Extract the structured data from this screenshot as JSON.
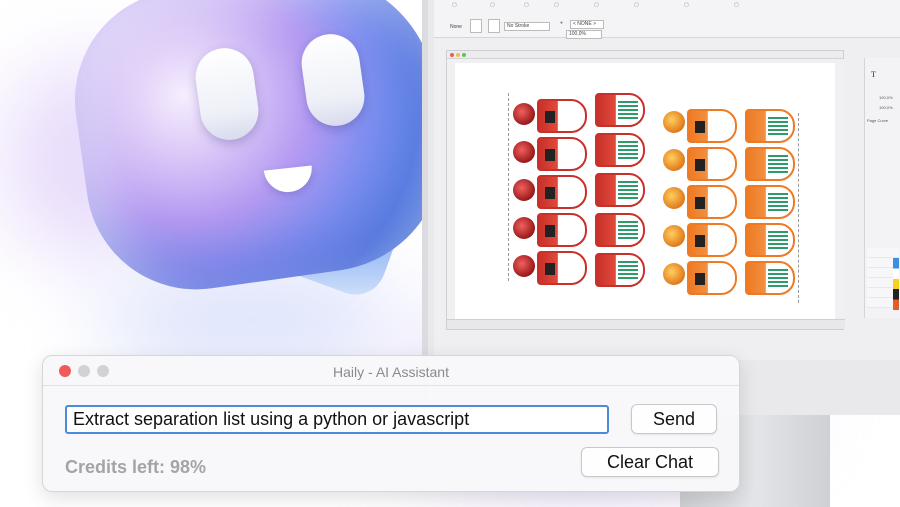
{
  "chat_window": {
    "title": "Haily - AI Assistant",
    "input_value": "Extract separation list using a python or javascript",
    "send_label": "Send",
    "credits_text": "Credits left: 98%",
    "clear_label": "Clear Chat"
  },
  "editor": {
    "fill_label": "None",
    "stroke_label": "No Stroke",
    "swatch_value": "< NONE >",
    "opacity_value": "100,0%",
    "panel_value_1": "100,0%",
    "panel_value_2": "100,0%",
    "panel_label": "Page Curve"
  },
  "colors": {
    "accent": "#4a8bdb",
    "close": "#ef5b57",
    "minimize": "#d2d2d6",
    "zoom": "#d2d2d6",
    "label_red": "#c8302a",
    "label_orange": "#ef7a23"
  }
}
